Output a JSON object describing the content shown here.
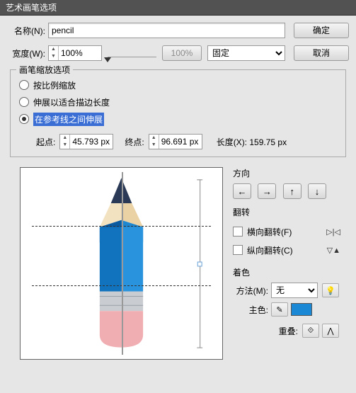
{
  "window": {
    "title": "艺术画笔选项"
  },
  "labels": {
    "name": "名称(N):",
    "width": "宽度(W):",
    "fixed": "固定",
    "ok": "确定",
    "cancel": "取消",
    "scaleGroup": "画笔缩放选项",
    "r1": "按比例缩放",
    "r2": "伸展以适合描边长度",
    "r3": "在参考线之间伸展",
    "start": "起点:",
    "end": "终点:",
    "length": "长度(X): 159.75 px",
    "direction": "方向",
    "flip": "翻转",
    "flipH": "横向翻转(F)",
    "flipV": "纵向翻转(C)",
    "colorize": "着色",
    "method": "方法(M):",
    "none": "无",
    "keyColor": "主色:",
    "overlap": "重叠:"
  },
  "values": {
    "name": "pencil",
    "width": "100%",
    "width2": "100%",
    "start": "45.793 px",
    "end": "96.691 px"
  },
  "dir": {
    "l": "←",
    "r": "→",
    "u": "↑",
    "d": "↓"
  },
  "icons": {
    "flipH": "▷|◁",
    "flipV": "▽▲",
    "eyedrop": "⁄",
    "ov1": "⟐",
    "ov2": "⋀"
  }
}
